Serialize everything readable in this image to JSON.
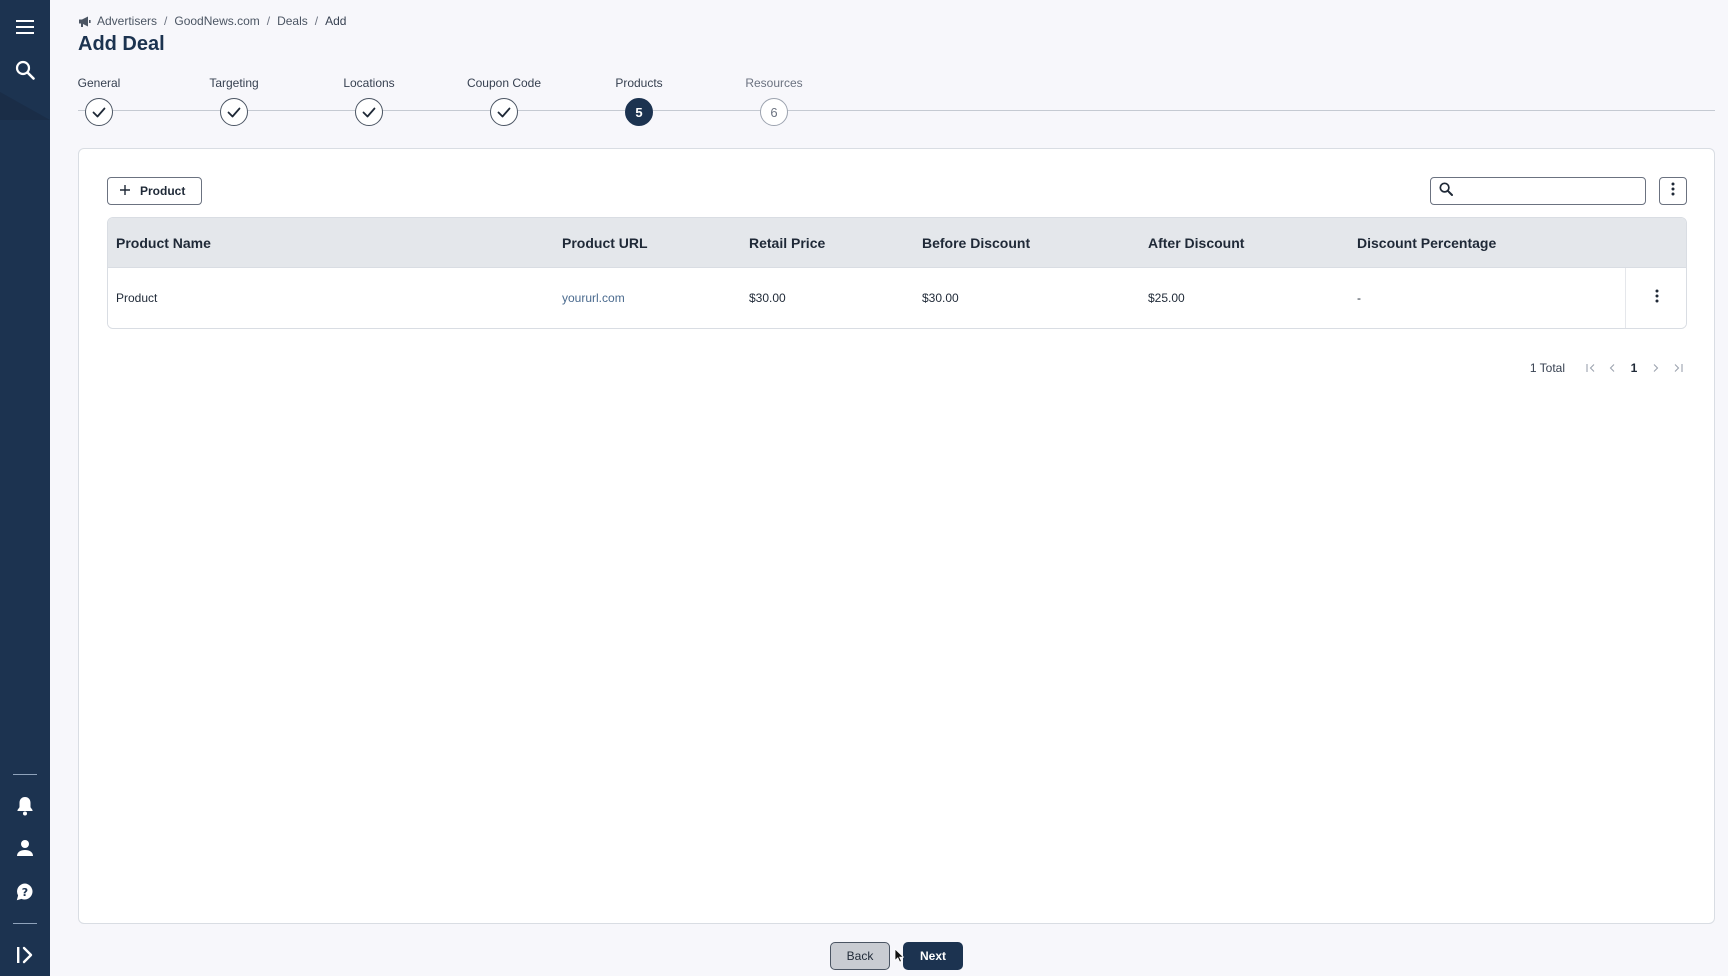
{
  "sidebar": {
    "icons": [
      "menu-icon",
      "search-icon",
      "bell-icon",
      "user-icon",
      "help-icon",
      "expand-sidebar-icon"
    ]
  },
  "breadcrumb": {
    "icon": "megaphone-icon",
    "items": [
      "Advertisers",
      "GoodNews.com",
      "Deals",
      "Add"
    ]
  },
  "page": {
    "title": "Add Deal"
  },
  "stepper": {
    "steps": [
      {
        "label": "General",
        "state": "complete",
        "number": ""
      },
      {
        "label": "Targeting",
        "state": "complete",
        "number": ""
      },
      {
        "label": "Locations",
        "state": "complete",
        "number": ""
      },
      {
        "label": "Coupon Code",
        "state": "complete",
        "number": ""
      },
      {
        "label": "Products",
        "state": "active",
        "number": "5"
      },
      {
        "label": "Resources",
        "state": "pending",
        "number": "6"
      }
    ]
  },
  "toolbar": {
    "add_label": "Product",
    "search_value": "",
    "search_placeholder": ""
  },
  "table": {
    "columns": [
      "Product Name",
      "Product URL",
      "Retail Price",
      "Before Discount",
      "After Discount",
      "Discount Percentage"
    ],
    "rows": [
      {
        "name": "Product",
        "url": "yoururl.com",
        "retail": "$30.00",
        "before": "$30.00",
        "after": "$25.00",
        "percent": "-"
      }
    ]
  },
  "pagination": {
    "total": "1 Total",
    "current": "1"
  },
  "footer": {
    "back_label": "Back",
    "next_label": "Next"
  },
  "colors": {
    "sidebar": "#1c3350",
    "primary": "#1c3350",
    "link": "#4a6a8e",
    "table_header": "#e4e7eb"
  }
}
